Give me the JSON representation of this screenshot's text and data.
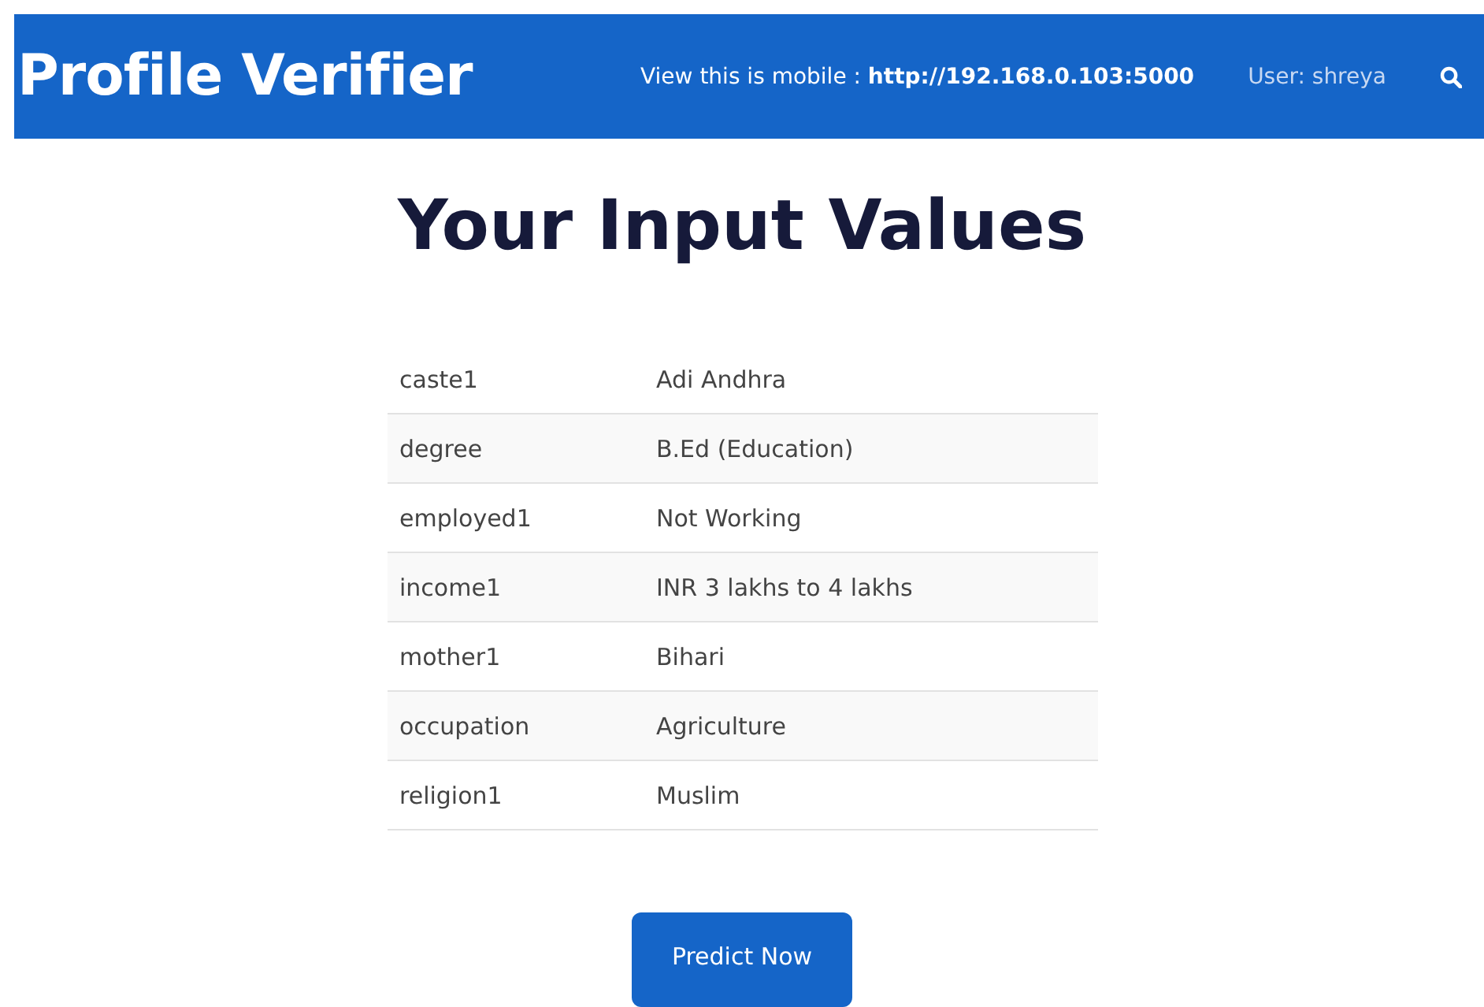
{
  "header": {
    "title": "Profile Verifier",
    "mobile_label": "View this is mobile :",
    "mobile_url": "http://192.168.0.103:5000",
    "user": "User: shreya"
  },
  "heading": "Your Input Values",
  "table": {
    "rows": [
      {
        "field": "caste1",
        "value": "Adi Andhra"
      },
      {
        "field": "degree",
        "value": "B.Ed (Education)"
      },
      {
        "field": "employed1",
        "value": "Not Working"
      },
      {
        "field": "income1",
        "value": "INR 3 lakhs to 4 lakhs"
      },
      {
        "field": "mother1",
        "value": "Bihari"
      },
      {
        "field": "occupation",
        "value": "Agriculture"
      },
      {
        "field": "religion1",
        "value": "Muslim"
      }
    ]
  },
  "button": "Predict Now"
}
